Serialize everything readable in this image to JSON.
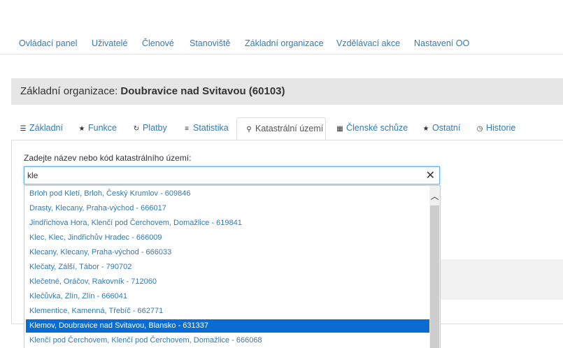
{
  "nav": {
    "items": [
      "Ovládací panel",
      "Uživatelé",
      "Členové",
      "Stanoviště",
      "Základní organizace",
      "Vzdělávací akce",
      "Nastavení OO"
    ]
  },
  "org": {
    "prefix": "Základní organizace: ",
    "name": "Doubravice nad Svitavou (60103)"
  },
  "tabs": [
    {
      "label": "Základní",
      "icon": "list-icon"
    },
    {
      "label": "Funkce",
      "icon": "star-icon"
    },
    {
      "label": "Platby",
      "icon": "refresh-icon"
    },
    {
      "label": "Statistika",
      "icon": "bars-icon"
    },
    {
      "label": "Katastrální území",
      "icon": "map-marker-icon",
      "active": true
    },
    {
      "label": "Členské schůze",
      "icon": "calendar-icon"
    },
    {
      "label": "Ostatní",
      "icon": "star-icon"
    },
    {
      "label": "Historie",
      "icon": "clock-icon"
    }
  ],
  "search": {
    "label": "Zadejte název nebo kód katastrálního území:",
    "value": "kle",
    "clear_glyph": "✕"
  },
  "results": [
    "Brloh pod Kletí, Brloh, Český Krumlov - 609846",
    "Drasty, Klecany, Praha-východ - 666017",
    "Jindřichova Hora, Klenčí pod Čerchovem, Domažlice - 619841",
    "Klec, Klec, Jindřichův Hradec - 666009",
    "Klecany, Klecany, Praha-východ - 666033",
    "Klečaty, Zálší, Tábor - 790702",
    "Klečetné, Oráčov, Rakovník - 712060",
    "Klečůvka, Zlín, Zlín - 666041",
    "Klementice, Kamenná, Třebíč - 662771",
    "Klemov, Doubravice nad Svitavou, Blansko - 631337",
    "Klenčí pod Čerchovem, Klenčí pod Čerchovem, Domažlice - 666068"
  ],
  "selected_index": 9,
  "colors": {
    "link": "#337ab7",
    "selected_bg": "#0a6cd3",
    "header_bg": "#e6e6e6"
  }
}
